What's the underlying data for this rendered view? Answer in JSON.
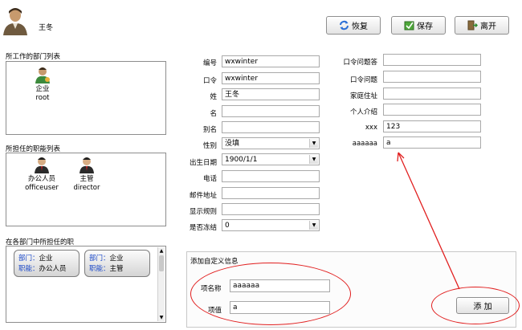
{
  "user": {
    "name": "王冬",
    "avatar_icon": "user-avatar-icon"
  },
  "toolbar": {
    "restore_label": "恢复",
    "save_label": "保存",
    "leave_label": "离开"
  },
  "departments": {
    "title": "所工作的部门列表",
    "items": [
      {
        "name": "企业",
        "code": "root"
      }
    ]
  },
  "roles": {
    "title": "所担任的职能列表",
    "items": [
      {
        "name": "办公人员",
        "code": "officeuser"
      },
      {
        "name": "主管",
        "code": "director"
      }
    ]
  },
  "dept_roles": {
    "title": "在各部门中所担任的职",
    "dept_key": "部门：",
    "role_key": "职能：",
    "cards": [
      {
        "dept": "企业",
        "role": "办公人员"
      },
      {
        "dept": "企业",
        "role": "主管"
      }
    ]
  },
  "form_left": [
    {
      "label": "编号",
      "value": "wxwinter"
    },
    {
      "label": "口令",
      "value": "wxwinter"
    },
    {
      "label": "姓",
      "value": "王冬"
    },
    {
      "label": "名",
      "value": ""
    },
    {
      "label": "别名",
      "value": ""
    },
    {
      "label": "性别",
      "value": "没填"
    },
    {
      "label": "出生日期",
      "value": "1900/1/1"
    },
    {
      "label": "电话",
      "value": ""
    },
    {
      "label": "邮件地址",
      "value": ""
    },
    {
      "label": "显示规则",
      "value": ""
    },
    {
      "label": "是否冻结",
      "value": "0"
    }
  ],
  "form_right": [
    {
      "label": "口令问题答",
      "value": ""
    },
    {
      "label": "口令问题",
      "value": ""
    },
    {
      "label": "家庭住址",
      "value": ""
    },
    {
      "label": "个人介绍",
      "value": ""
    },
    {
      "label": "xxx",
      "value": "123"
    },
    {
      "label": "aaaaaa",
      "value": "a"
    }
  ],
  "custom": {
    "title": "添加自定义信息",
    "name_label": "项名称",
    "name_value": "aaaaaa",
    "value_label": "项值",
    "value_value": "a",
    "add_label": "添 加"
  },
  "colors": {
    "annotation": "#e11f1f",
    "card_key": "#1a48c9"
  }
}
